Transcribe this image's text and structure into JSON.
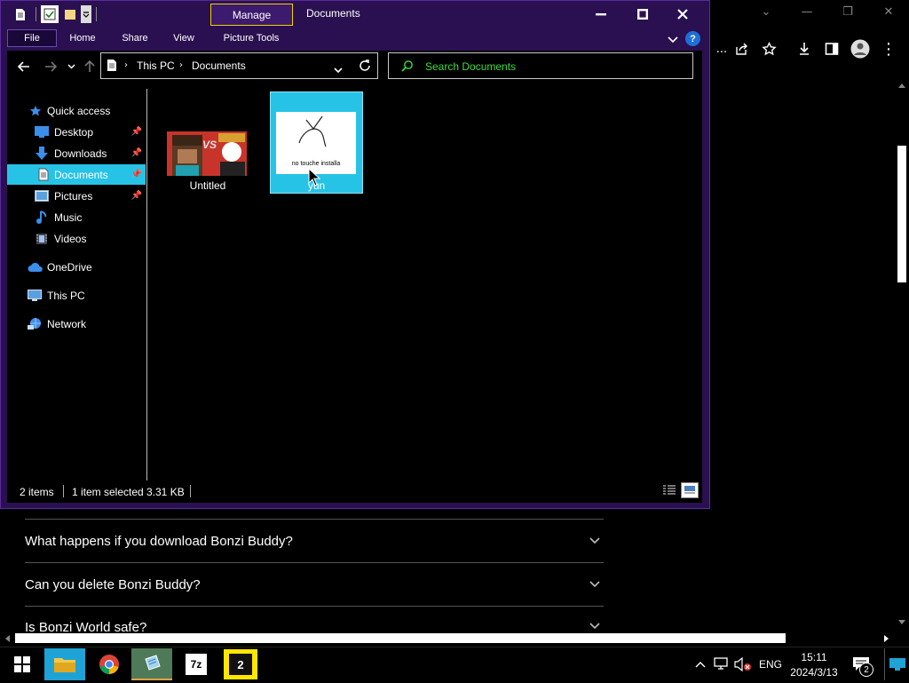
{
  "browser": {
    "window_controls": {
      "dropdown": "⌄",
      "minimize": "—",
      "restore": "❐",
      "close": "✕"
    },
    "toolbar": {
      "more_label": "...",
      "menu_icon": "⋮"
    },
    "faq": [
      {
        "question": "What happens if you download Bonzi Buddy?"
      },
      {
        "question": "Can you delete Bonzi Buddy?"
      },
      {
        "question": "Is Bonzi World safe?"
      }
    ]
  },
  "explorer": {
    "title": "Documents",
    "manage_tab": "Manage",
    "ribbon_tabs": [
      "File",
      "Home",
      "Share",
      "View",
      "Picture Tools"
    ],
    "breadcrumb": [
      "This PC",
      "Documents"
    ],
    "search_placeholder": "Search Documents",
    "sidebar": {
      "quick_access": "Quick access",
      "items": [
        {
          "label": "Desktop",
          "pinned": true
        },
        {
          "label": "Downloads",
          "pinned": true
        },
        {
          "label": "Documents",
          "pinned": true,
          "selected": true
        },
        {
          "label": "Pictures",
          "pinned": true
        },
        {
          "label": "Music",
          "pinned": false
        },
        {
          "label": "Videos",
          "pinned": false
        }
      ],
      "onedrive": "OneDrive",
      "this_pc": "This PC",
      "network": "Network"
    },
    "files": [
      {
        "name": "Untitled",
        "thumb_text": "VS",
        "selected": false
      },
      {
        "name": "yun",
        "thumb_text": "no touche installa",
        "selected": true
      }
    ],
    "status": {
      "count": "2 items",
      "selection": "1 item selected",
      "size": "3.31 KB"
    }
  },
  "taskbar": {
    "apps": [
      {
        "name": "File Explorer",
        "active": true
      },
      {
        "name": "Google Chrome",
        "active": false
      },
      {
        "name": "Notepad",
        "active": true
      },
      {
        "name": "7-Zip",
        "label": "7z",
        "active": false
      },
      {
        "name": "App",
        "label": "2",
        "active": false
      }
    ],
    "tray": {
      "language": "ENG",
      "time": "15:11",
      "date": "2024/3/13",
      "notification_count": "2"
    }
  },
  "colors": {
    "explorer_frame": "#2a1050",
    "selection": "#27c3e6",
    "manage_border": "#f0d000",
    "search_text": "#3ddc3d",
    "taskbar_active": "#1fa3d6"
  }
}
